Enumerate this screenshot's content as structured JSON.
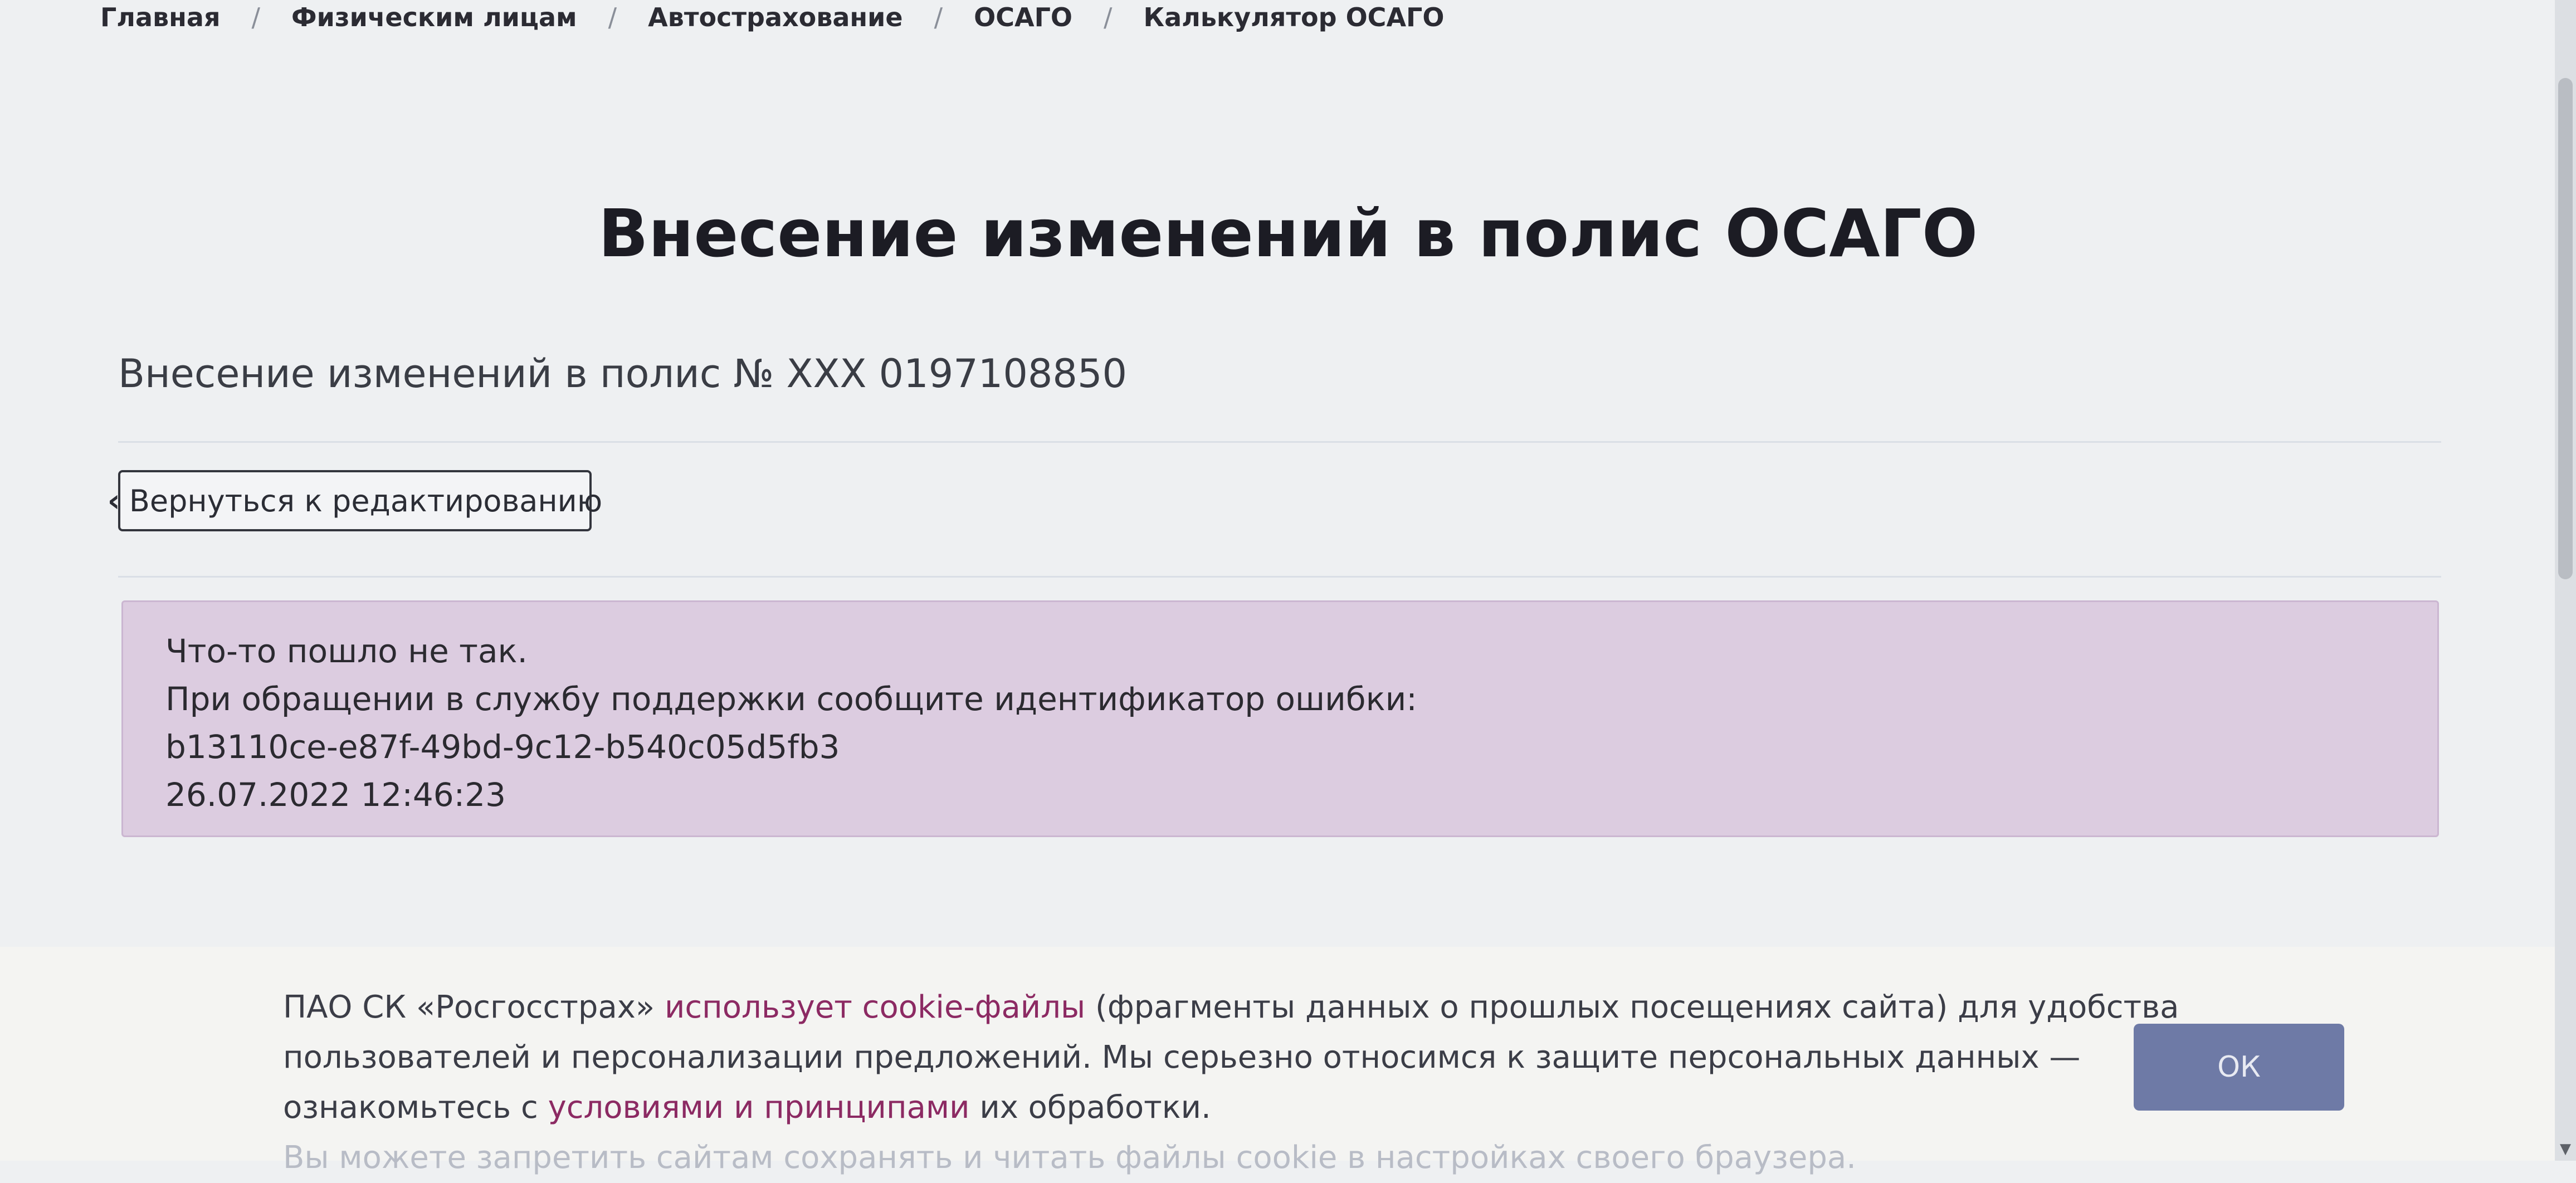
{
  "breadcrumb": [
    {
      "label": "Главная"
    },
    {
      "label": "Физическим лицам"
    },
    {
      "label": "Автострахование"
    },
    {
      "label": "ОСАГО"
    },
    {
      "label": "Калькулятор ОСАГО"
    }
  ],
  "breadcrumb_separator": "/",
  "page": {
    "title": "Внесение изменений в полис ОСАГО",
    "subtitle": "Внесение изменений в полис № XXX 0197108850"
  },
  "back_button": {
    "icon": "chevron-left-icon",
    "glyph": "‹",
    "label": "Вернуться к редактированию"
  },
  "error": {
    "message": "Что-то пошло не так.",
    "instruction": "При обращении в службу поддержки сообщите идентификатор ошибки:",
    "id": "b13110ce-e87f-49bd-9c12-b540c05d5fb3",
    "timestamp": "26.07.2022 12:46:23"
  },
  "cookie": {
    "part1": "ПАО СК «Росгосстрах» ",
    "link1": "использует cookie-файлы",
    "part2": " (фрагменты данных о прошлых посещениях сайта) для удобства",
    "line2": "пользователей и персонализации предложений. Мы серьезно относимся к защите персональных данных —",
    "part3": "ознакомьтесь с ",
    "link2": "условиями и принципами",
    "part4": " их обработки.",
    "line4": "Вы можете запретить сайтам сохранять и читать файлы cookie в настройках своего браузера.",
    "ok_label": "ОК"
  },
  "colors": {
    "error_bg": "#dccce0",
    "link": "#8c2a63",
    "ok_button": "#6e7aa6"
  }
}
